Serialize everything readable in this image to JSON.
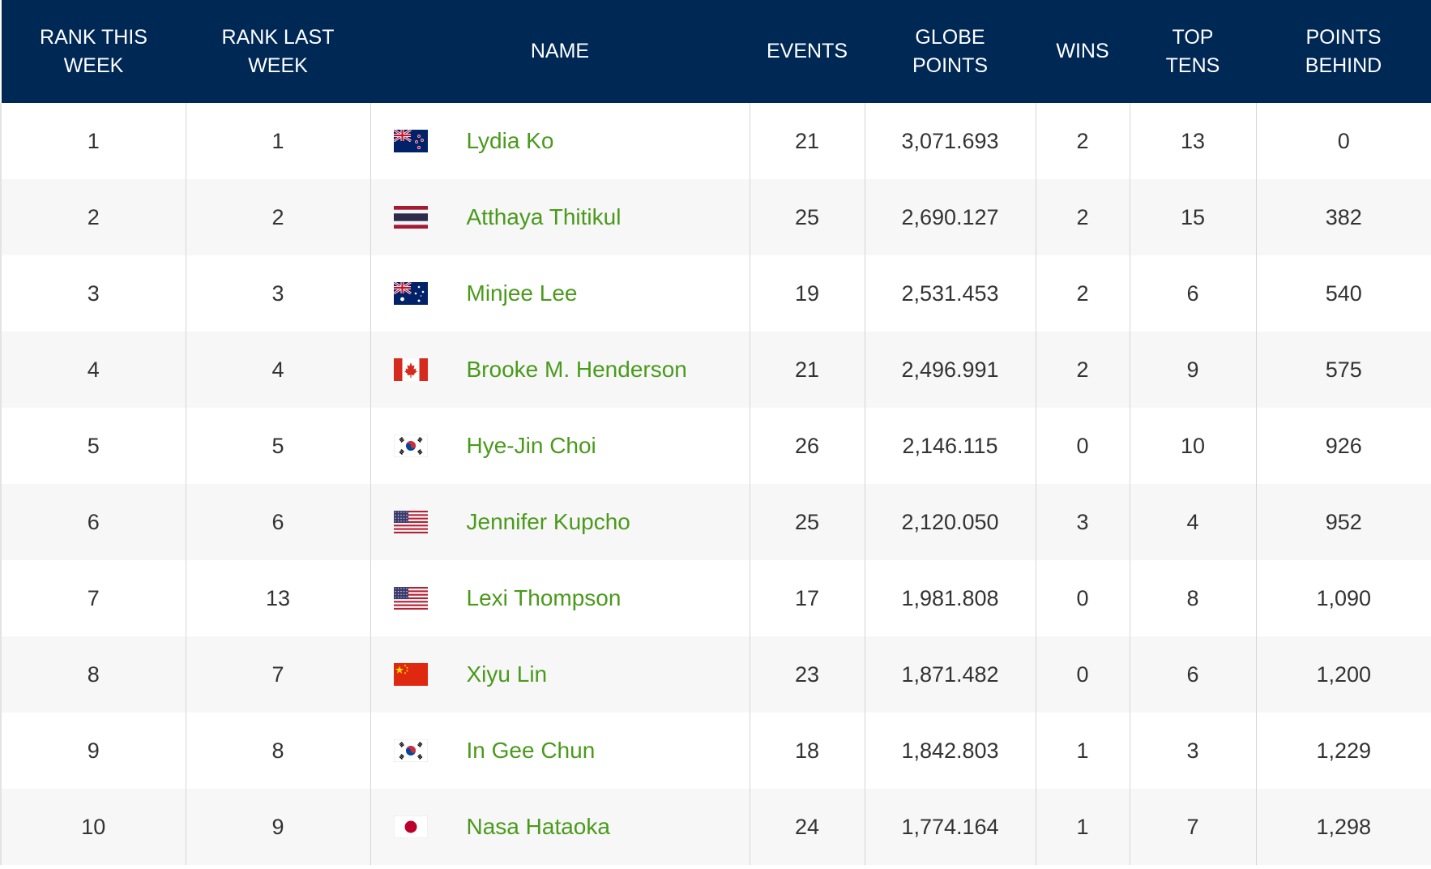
{
  "columns": {
    "rank_this_week": "RANK THIS\nWEEK",
    "rank_last_week": "RANK LAST\nWEEK",
    "name": "NAME",
    "events": "EVENTS",
    "globe_points": "GLOBE\nPOINTS",
    "wins": "WINS",
    "top_tens": "TOP\nTENS",
    "points_behind": "POINTS\nBEHIND"
  },
  "colors": {
    "header_bg": "#002855",
    "link": "#4a9a1c",
    "stripe": "#f7f7f7"
  },
  "rows": [
    {
      "rank": "1",
      "last": "1",
      "flag": "flag-new-zealand-icon",
      "name": "Lydia Ko",
      "events": "21",
      "globe": "3,071.693",
      "wins": "2",
      "top10": "13",
      "behind": "0"
    },
    {
      "rank": "2",
      "last": "2",
      "flag": "flag-thailand-icon",
      "name": "Atthaya Thitikul",
      "events": "25",
      "globe": "2,690.127",
      "wins": "2",
      "top10": "15",
      "behind": "382"
    },
    {
      "rank": "3",
      "last": "3",
      "flag": "flag-australia-icon",
      "name": "Minjee Lee",
      "events": "19",
      "globe": "2,531.453",
      "wins": "2",
      "top10": "6",
      "behind": "540"
    },
    {
      "rank": "4",
      "last": "4",
      "flag": "flag-canada-icon",
      "name": "Brooke M. Henderson",
      "events": "21",
      "globe": "2,496.991",
      "wins": "2",
      "top10": "9",
      "behind": "575"
    },
    {
      "rank": "5",
      "last": "5",
      "flag": "flag-south-korea-icon",
      "name": "Hye-Jin Choi",
      "events": "26",
      "globe": "2,146.115",
      "wins": "0",
      "top10": "10",
      "behind": "926"
    },
    {
      "rank": "6",
      "last": "6",
      "flag": "flag-usa-icon",
      "name": "Jennifer Kupcho",
      "events": "25",
      "globe": "2,120.050",
      "wins": "3",
      "top10": "4",
      "behind": "952"
    },
    {
      "rank": "7",
      "last": "13",
      "flag": "flag-usa-icon",
      "name": "Lexi Thompson",
      "events": "17",
      "globe": "1,981.808",
      "wins": "0",
      "top10": "8",
      "behind": "1,090"
    },
    {
      "rank": "8",
      "last": "7",
      "flag": "flag-china-icon",
      "name": "Xiyu Lin",
      "events": "23",
      "globe": "1,871.482",
      "wins": "0",
      "top10": "6",
      "behind": "1,200"
    },
    {
      "rank": "9",
      "last": "8",
      "flag": "flag-south-korea-icon",
      "name": "In Gee Chun",
      "events": "18",
      "globe": "1,842.803",
      "wins": "1",
      "top10": "3",
      "behind": "1,229"
    },
    {
      "rank": "10",
      "last": "9",
      "flag": "flag-japan-icon",
      "name": "Nasa Hataoka",
      "events": "24",
      "globe": "1,774.164",
      "wins": "1",
      "top10": "7",
      "behind": "1,298"
    }
  ]
}
